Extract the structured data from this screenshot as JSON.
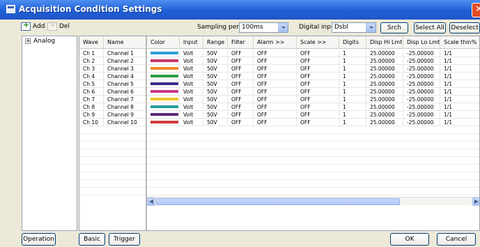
{
  "window": {
    "title": "Acquisition Condition Settings"
  },
  "toolbar": {
    "add_label": "Add",
    "del_label": "Del",
    "sampling_label": "Sampling period",
    "sampling_value": "100ms",
    "digital_label": "Digital input",
    "digital_value": "Dsbl",
    "srch_label": "Srch",
    "select_all_label": "Select All",
    "deselect_label": "Deselect"
  },
  "tree": {
    "root_label": "Analog",
    "expander": "+"
  },
  "grid": {
    "columns": [
      "Wave",
      "Name",
      "Color",
      "Input",
      "Range",
      "Filter",
      "Alarm >>",
      "Scale >>",
      "Digits",
      "Disp Hi Lmt",
      "Disp Lo Lmt",
      "Scale thin%"
    ],
    "rows": [
      {
        "wave": "Ch 1",
        "name": "Channel 1",
        "color": "#2f9fd6",
        "input": "Volt",
        "range": "50V",
        "filter": "OFF",
        "alarm": "OFF",
        "scale": "OFF",
        "digits": "1",
        "hi": "25.00000",
        "lo": "-25.00000",
        "thin": "1/1"
      },
      {
        "wave": "Ch 2",
        "name": "Channel 2",
        "color": "#c8336c",
        "input": "Volt",
        "range": "50V",
        "filter": "OFF",
        "alarm": "OFF",
        "scale": "OFF",
        "digits": "1",
        "hi": "25.00000",
        "lo": "-25.00000",
        "thin": "1/1"
      },
      {
        "wave": "Ch 3",
        "name": "Channel 3",
        "color": "#f08a2a",
        "input": "Volt",
        "range": "50V",
        "filter": "OFF",
        "alarm": "OFF",
        "scale": "OFF",
        "digits": "1",
        "hi": "25.00000",
        "lo": "-25.00000",
        "thin": "1/1"
      },
      {
        "wave": "Ch 4",
        "name": "Channel 4",
        "color": "#2e9a48",
        "input": "Volt",
        "range": "50V",
        "filter": "OFF",
        "alarm": "OFF",
        "scale": "OFF",
        "digits": "1",
        "hi": "25.00000",
        "lo": "-25.00000",
        "thin": "1/1"
      },
      {
        "wave": "Ch 5",
        "name": "Channel 5",
        "color": "#3a2a8c",
        "input": "Volt",
        "range": "50V",
        "filter": "OFF",
        "alarm": "OFF",
        "scale": "OFF",
        "digits": "1",
        "hi": "25.00000",
        "lo": "-25.00000",
        "thin": "1/1"
      },
      {
        "wave": "Ch 6",
        "name": "Channel 6",
        "color": "#c83a8a",
        "input": "Volt",
        "range": "50V",
        "filter": "OFF",
        "alarm": "OFF",
        "scale": "OFF",
        "digits": "1",
        "hi": "25.00000",
        "lo": "-25.00000",
        "thin": "1/1"
      },
      {
        "wave": "Ch 7",
        "name": "Channel 7",
        "color": "#f2c62a",
        "input": "Volt",
        "range": "50V",
        "filter": "OFF",
        "alarm": "OFF",
        "scale": "OFF",
        "digits": "1",
        "hi": "25.00000",
        "lo": "-25.00000",
        "thin": "1/1"
      },
      {
        "wave": "Ch 8",
        "name": "Channel 8",
        "color": "#2a9a9a",
        "input": "Volt",
        "range": "50V",
        "filter": "OFF",
        "alarm": "OFF",
        "scale": "OFF",
        "digits": "1",
        "hi": "25.00000",
        "lo": "-25.00000",
        "thin": "1/1"
      },
      {
        "wave": "Ch 9",
        "name": "Channel 9",
        "color": "#5a2a7a",
        "input": "Volt",
        "range": "50V",
        "filter": "OFF",
        "alarm": "OFF",
        "scale": "OFF",
        "digits": "1",
        "hi": "25.00000",
        "lo": "-25.00000",
        "thin": "1/1"
      },
      {
        "wave": "Ch 10",
        "name": "Channel 10",
        "color": "#d03a3a",
        "input": "Volt",
        "range": "50V",
        "filter": "OFF",
        "alarm": "OFF",
        "scale": "OFF",
        "digits": "1",
        "hi": "25.00000",
        "lo": "-25.00000",
        "thin": "1/1"
      }
    ]
  },
  "footer": {
    "operation_label": "Operation",
    "basic_label": "Basic",
    "trigger_label": "Trigger",
    "ok_label": "OK",
    "cancel_label": "Cancel"
  }
}
